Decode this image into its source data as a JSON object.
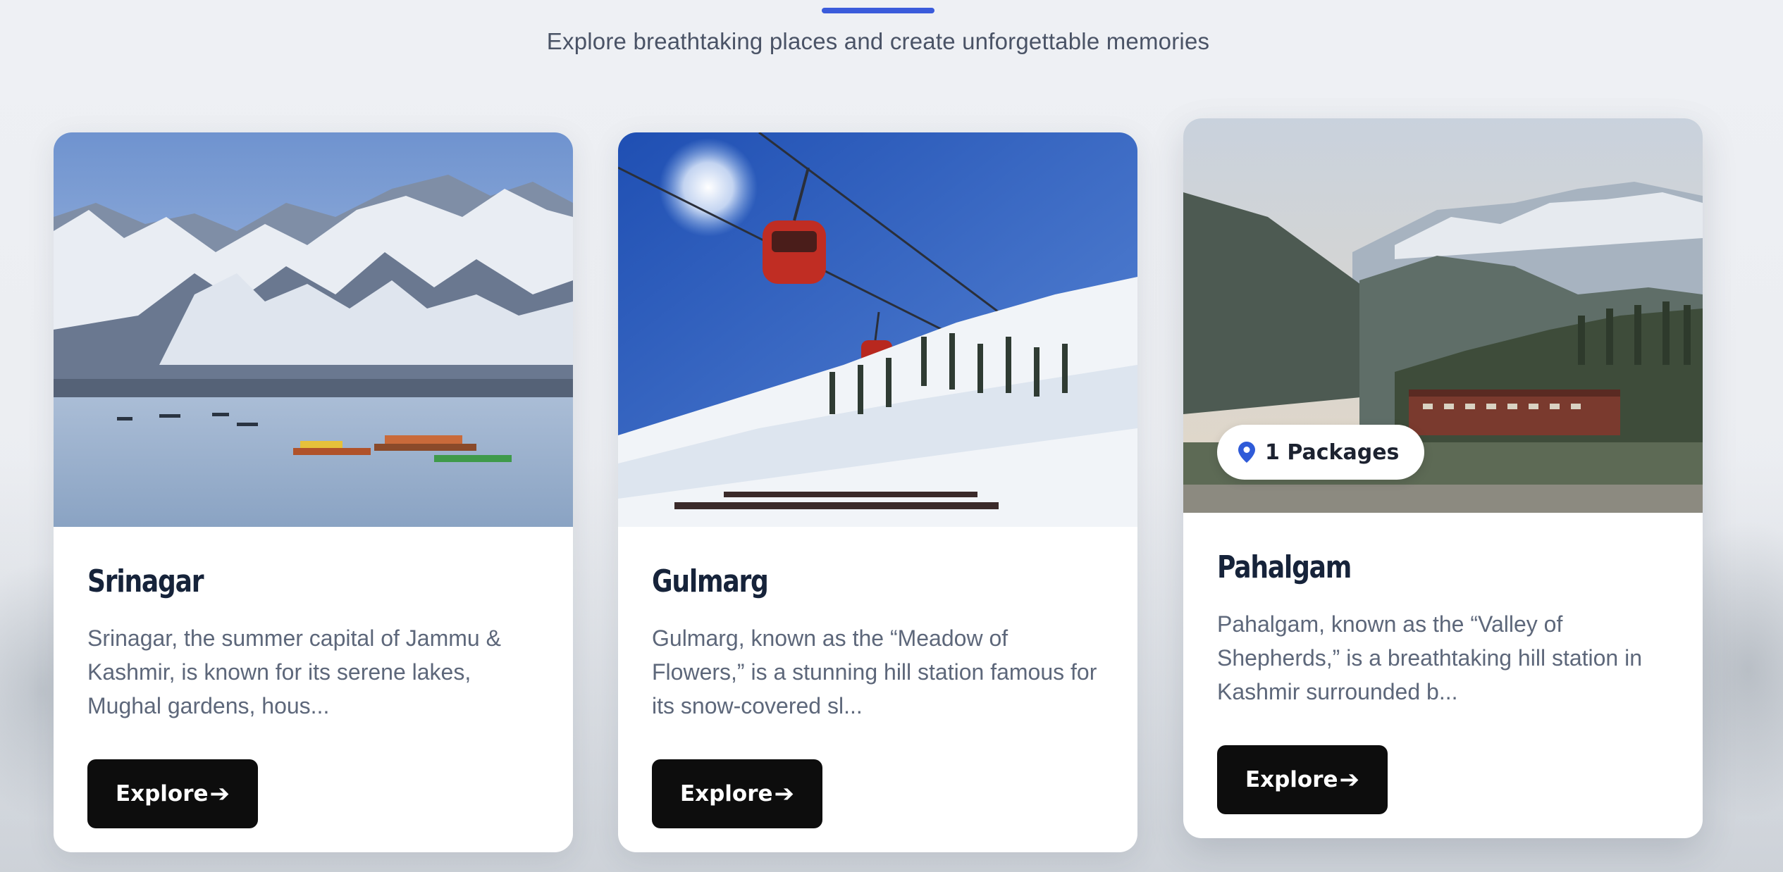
{
  "header": {
    "subtitle": "Explore breathtaking places and create unforgettable memories"
  },
  "destinations": [
    {
      "name": "Srinagar",
      "description": "Srinagar, the summer capital of Jammu & Kashmir, is known for its serene lakes, Mughal gardens, hous...",
      "button_label": "Explore"
    },
    {
      "name": "Gulmarg",
      "description": "Gulmarg, known as the “Meadow of Flowers,” is a stunning hill station famous for its snow-covered sl...",
      "button_label": "Explore"
    },
    {
      "name": "Pahalgam",
      "description": "Pahalgam, known as the “Valley of Shepherds,” is a breathtaking hill station in Kashmir surrounded b...",
      "button_label": "Explore",
      "badge": "1 Packages"
    }
  ],
  "colors": {
    "accent": "#3a5bdb",
    "button_bg": "#0d0d0d",
    "heading": "#16233a",
    "text": "#5d677a"
  }
}
